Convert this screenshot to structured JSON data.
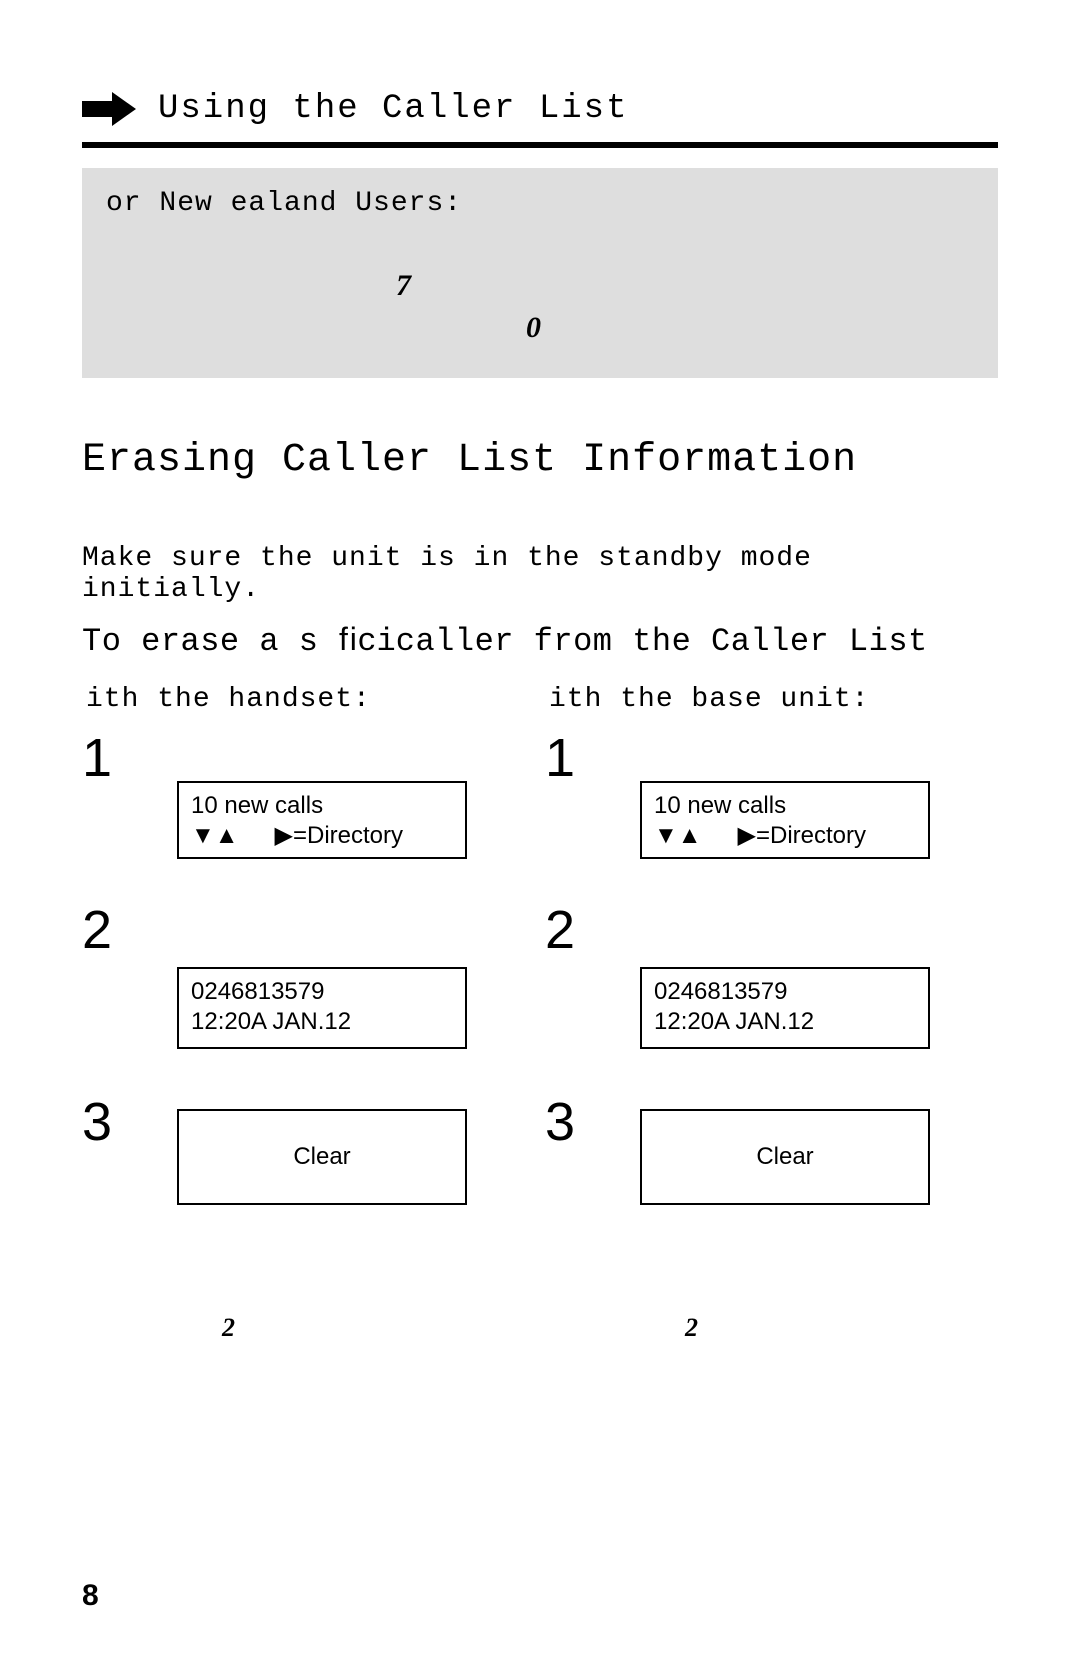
{
  "header": {
    "title": "Using the Caller List"
  },
  "note_box": {
    "line": "or New  ealand Users:",
    "num_a": "7",
    "num_b": "0"
  },
  "section": {
    "heading": "Erasing Caller List Information",
    "intro": "Make sure the unit is in the standby mode initially.",
    "sub_prefix": "To erase a s ",
    "sub_glued": "ﬁci",
    "sub_suffix": "caller from the Caller List"
  },
  "columns": {
    "left": {
      "header": "ith the handset:",
      "step1_num": "1",
      "step1_line1": "10 new calls",
      "step1_arrows": "▼▲",
      "step1_dir": "▶=Directory",
      "step2_num": "2",
      "step2_line1": "0246813579",
      "step2_line2": "12:20A JAN.12",
      "step3_num": "3",
      "step3_label": "Clear",
      "footnote": "2"
    },
    "right": {
      "header": "ith the base unit:",
      "step1_num": "1",
      "step1_line1": "10 new calls",
      "step1_arrows": "▼▲",
      "step1_dir": "▶=Directory",
      "step2_num": "2",
      "step2_line1": "0246813579",
      "step2_line2": "12:20A JAN.12",
      "step3_num": "3",
      "step3_label": "Clear",
      "footnote": "2"
    }
  },
  "page_number": "8"
}
